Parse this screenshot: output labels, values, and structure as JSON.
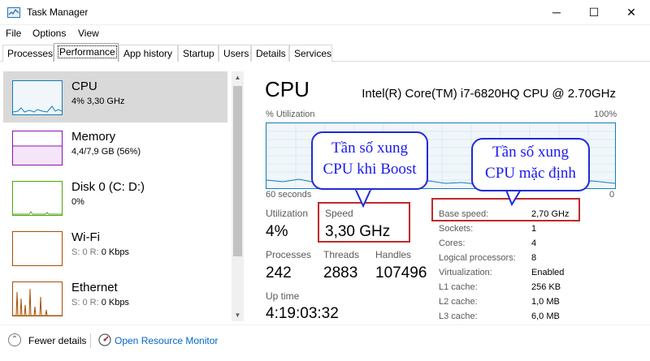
{
  "window": {
    "title": "Task Manager",
    "minimize_glyph": "─",
    "maximize_glyph": "☐",
    "close_glyph": "✕"
  },
  "menu": {
    "file": "File",
    "options": "Options",
    "view": "View"
  },
  "tabs": [
    {
      "label": "Processes"
    },
    {
      "label": "Performance"
    },
    {
      "label": "App history"
    },
    {
      "label": "Startup"
    },
    {
      "label": "Users"
    },
    {
      "label": "Details"
    },
    {
      "label": "Services"
    }
  ],
  "resources": [
    {
      "name": "CPU",
      "value": "4% 3,30 GHz",
      "color": "#117dbb"
    },
    {
      "name": "Memory",
      "value": "4,4/7,9 GB (56%)",
      "color": "#8b12ae"
    },
    {
      "name": "Disk 0 (C: D:)",
      "value": "0%",
      "color": "#4da60c"
    },
    {
      "name": "Wi-Fi",
      "value_prefix": "S: 0 R: ",
      "value": "0 Kbps",
      "color": "#a74f01"
    },
    {
      "name": "Ethernet",
      "value_prefix": "S: 0 R: ",
      "value": "0 Kbps",
      "color": "#a74f01"
    }
  ],
  "cpu": {
    "title": "CPU",
    "model": "Intel(R) Core(TM) i7-6820HQ CPU @ 2.70GHz",
    "util_label": "% Utilization",
    "util_max": "100%",
    "time_label": "60 seconds",
    "zero_label": "0",
    "utilization_label": "Utilization",
    "utilization": "4%",
    "speed_label": "Speed",
    "speed": "3,30 GHz",
    "processes_label": "Processes",
    "processes": "242",
    "threads_label": "Threads",
    "threads": "2883",
    "handles_label": "Handles",
    "handles": "107496",
    "uptime_label": "Up time",
    "uptime": "4:19:03:32",
    "details": [
      {
        "label": "Base speed:",
        "value": "2,70 GHz"
      },
      {
        "label": "Sockets:",
        "value": "1"
      },
      {
        "label": "Cores:",
        "value": "4"
      },
      {
        "label": "Logical processors:",
        "value": "8"
      },
      {
        "label": "Virtualization:",
        "value": "Enabled"
      },
      {
        "label": "L1 cache:",
        "value": "256 KB"
      },
      {
        "label": "L2 cache:",
        "value": "1,0 MB"
      },
      {
        "label": "L3 cache:",
        "value": "6,0 MB"
      }
    ]
  },
  "callouts": {
    "boost_line1": "Tần số xung",
    "boost_line2": "CPU khi Boost",
    "base_line1": "Tần số xung",
    "base_line2": "CPU mặc định"
  },
  "footer": {
    "fewer_details": "Fewer details",
    "open_resource_monitor": "Open Resource Monitor"
  },
  "colors": {
    "cpu_accent": "#117dbb",
    "highlight_box": "#c0292b",
    "callout_blue": "#1a1af0"
  }
}
